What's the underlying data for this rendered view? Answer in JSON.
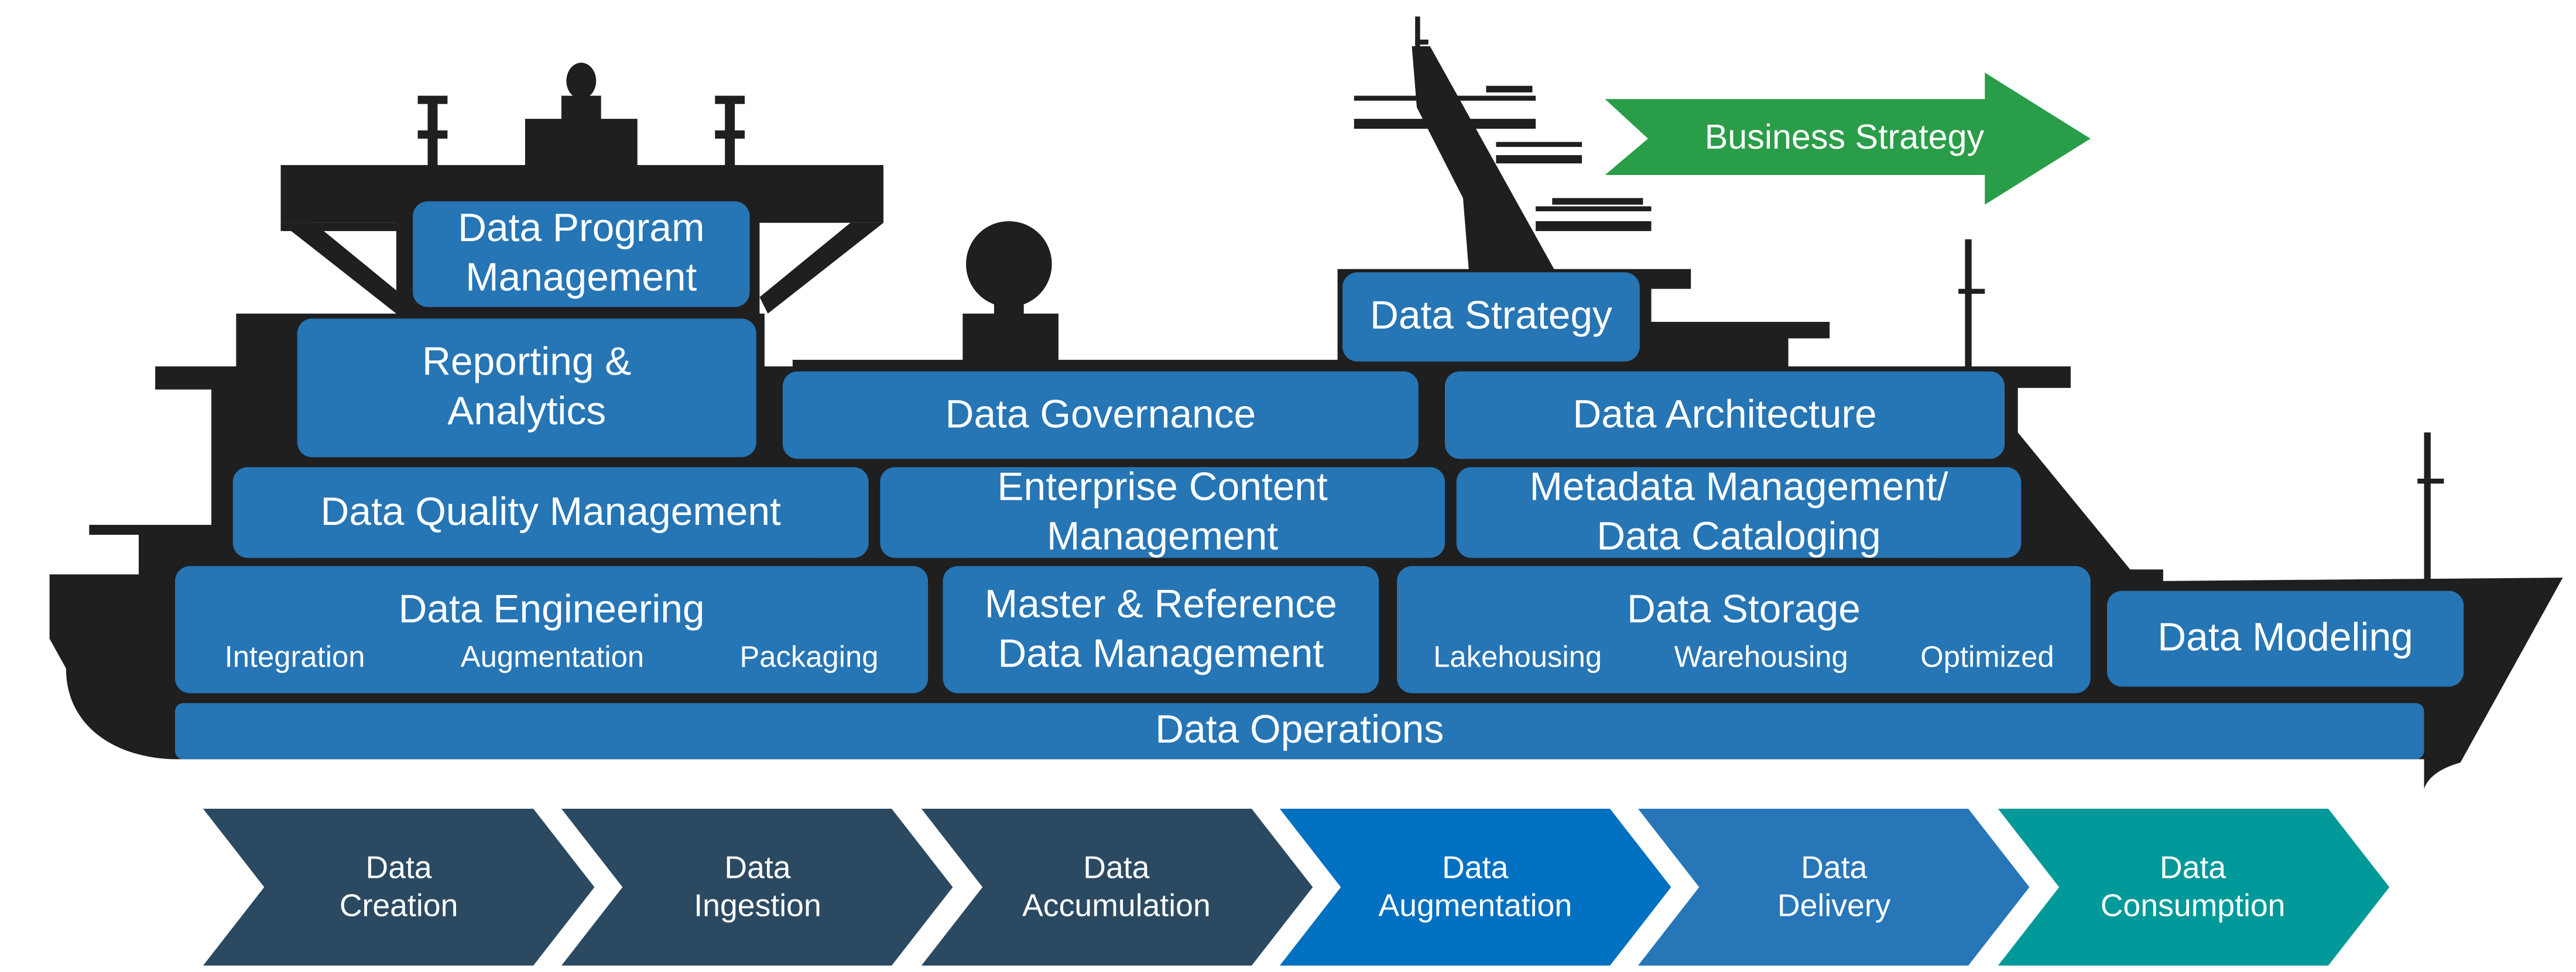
{
  "diagram": {
    "title": "Data management ship",
    "colors": {
      "ship": "#1F1F1F",
      "box": "#2675B5",
      "business_strategy": "#2A9D48",
      "text": "#FFFFFF"
    },
    "business_strategy": {
      "label": "Business Strategy"
    },
    "boxes": {
      "data_program_management": {
        "label": "Data Program\nManagement"
      },
      "reporting_analytics": {
        "label": "Reporting &\nAnalytics"
      },
      "data_strategy": {
        "label": "Data Strategy"
      },
      "data_governance": {
        "label": "Data Governance"
      },
      "data_architecture": {
        "label": "Data Architecture"
      },
      "data_quality_management": {
        "label": "Data Quality Management"
      },
      "enterprise_content_management": {
        "label": "Enterprise Content\nManagement"
      },
      "metadata_management": {
        "label": "Metadata Management/\nData Cataloging"
      },
      "data_engineering": {
        "label": "Data Engineering",
        "sub": [
          "Integration",
          "Augmentation",
          "Packaging"
        ]
      },
      "master_reference": {
        "label": "Master & Reference\nData Management"
      },
      "data_storage": {
        "label": "Data Storage",
        "sub": [
          "Lakehousing",
          "Warehousing",
          "Optimized"
        ]
      },
      "data_modeling": {
        "label": "Data Modeling"
      },
      "data_operations": {
        "label": "Data Operations"
      }
    },
    "lifecycle": [
      {
        "label": "Data\nCreation",
        "color": "#2B4A62"
      },
      {
        "label": "Data\nIngestion",
        "color": "#2B4A62"
      },
      {
        "label": "Data\nAccumulation",
        "color": "#2B4A62"
      },
      {
        "label": "Data\nAugmentation",
        "color": "#0070C0"
      },
      {
        "label": "Data\nDelivery",
        "color": "#2776B8"
      },
      {
        "label": "Data\nConsumption",
        "color": "#009999"
      }
    ]
  }
}
